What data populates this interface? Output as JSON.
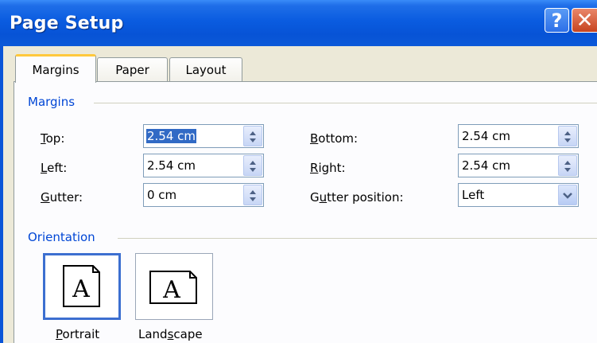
{
  "window": {
    "title": "Page Setup",
    "help_label": "?",
    "close_label": "✕"
  },
  "tabs": [
    {
      "label": "Margins",
      "active": true
    },
    {
      "label": "Paper",
      "active": false
    },
    {
      "label": "Layout",
      "active": false
    }
  ],
  "margins": {
    "group_label": "Margins",
    "top": {
      "label_u": "T",
      "label_rest": "op:",
      "value": "2.54 cm"
    },
    "bottom": {
      "label_u": "B",
      "label_rest": "ottom:",
      "value": "2.54 cm"
    },
    "left": {
      "label_u": "L",
      "label_rest": "eft:",
      "value": "2.54 cm"
    },
    "right": {
      "label_u": "R",
      "label_rest": "ight:",
      "value": "2.54 cm"
    },
    "gutter": {
      "label_u": "G",
      "label_rest": "utter:",
      "value": "0 cm"
    },
    "gutter_position": {
      "label_pre": "G",
      "label_u": "u",
      "label_rest": "tter position:",
      "value": "Left"
    }
  },
  "orientation": {
    "group_label": "Orientation",
    "portrait": {
      "label_u": "P",
      "label_rest": "ortrait",
      "glyph": "A",
      "selected": true
    },
    "landscape": {
      "label_pre": "Land",
      "label_u": "s",
      "label_rest": "cape",
      "glyph": "A",
      "selected": false
    }
  },
  "colors": {
    "title_bar": "#0753d6",
    "group_label": "#0046d5",
    "selection": "#316ac5",
    "active_tab_accent": "#ffc83c"
  }
}
